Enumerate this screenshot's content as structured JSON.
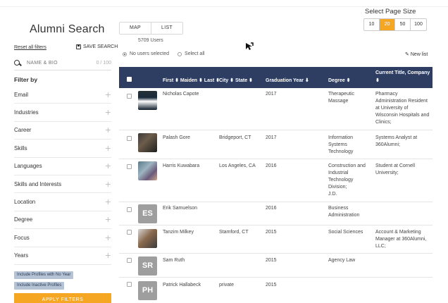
{
  "sidebar": {
    "title": "Alumni Search",
    "reset_label": "Reset all filters",
    "save_label": "SAVE SEARCH",
    "search_placeholder": "NAME & BIO",
    "search_count": "0 / 100",
    "filter_by": "Filter by",
    "filters": [
      "Email",
      "Industries",
      "Career",
      "Skills",
      "Languages",
      "Skills and Interests",
      "Location",
      "Degree",
      "Focus",
      "Years"
    ],
    "chip_no_year": "Include Profiles with No Year",
    "chip_inactive": "Include Inactive Profiles",
    "apply_label": "APPLY FILTERS"
  },
  "view": {
    "map": "MAP",
    "list": "LIST"
  },
  "users_count": "5709 Users",
  "selection": {
    "none": "No users selected",
    "all": "Select all"
  },
  "page_size": {
    "title": "Select Page Size",
    "options": [
      "10",
      "20",
      "50",
      "100"
    ],
    "selected": "20"
  },
  "new_list": "New list",
  "table": {
    "headers": {
      "name": "First ⬍ Maiden ⬍ Last ⬍",
      "location": "City ⬍ State ⬍",
      "year": "Graduation Year ⬇",
      "degree": "Degree ⬍",
      "title": "Current Title, Company",
      "title_sort": "⬍"
    },
    "rows": [
      {
        "name": "Nicholas Capote",
        "initials": "",
        "location": "",
        "year": "2017",
        "degree": [
          "Therapeutic",
          "Massage"
        ],
        "title": [
          "Pharmacy",
          "Administration Resident",
          "at University of",
          "Wisconsin Hospitals and",
          "Clinics;"
        ]
      },
      {
        "name": "Palash Gore",
        "initials": "",
        "location": "Bridgeport, CT",
        "year": "2017",
        "degree": [
          "Information",
          "Systems",
          "Technology"
        ],
        "title": [
          "Systems Analyst at",
          "360Alumni;"
        ]
      },
      {
        "name": "Harris Kuwabara",
        "initials": "",
        "location": "Los Angeles, CA",
        "year": "2016",
        "degree": [
          "Construction and",
          "Industrial",
          "Technology",
          "Division;",
          "J.D."
        ],
        "title": [
          "Student at Cornell",
          "University;"
        ]
      },
      {
        "name": "Erik Samuelson",
        "initials": "ES",
        "location": "",
        "year": "2016",
        "degree": [
          "Business",
          "Administration"
        ],
        "title": []
      },
      {
        "name": "Tanzim Milkey",
        "initials": "",
        "location": "Stamford, CT",
        "year": "2015",
        "degree": [
          "Social Sciences"
        ],
        "title": [
          "Account & Marketing",
          "Manager at 360Alumni,",
          "LLC;"
        ]
      },
      {
        "name": "Sam Ruth",
        "initials": "SR",
        "location": "",
        "year": "2015",
        "degree": [
          "Agency Law"
        ],
        "title": []
      },
      {
        "name": "Patrick Hallabeck",
        "initials": "PH",
        "location": "private",
        "year": "2015",
        "degree": [],
        "title": []
      }
    ]
  }
}
